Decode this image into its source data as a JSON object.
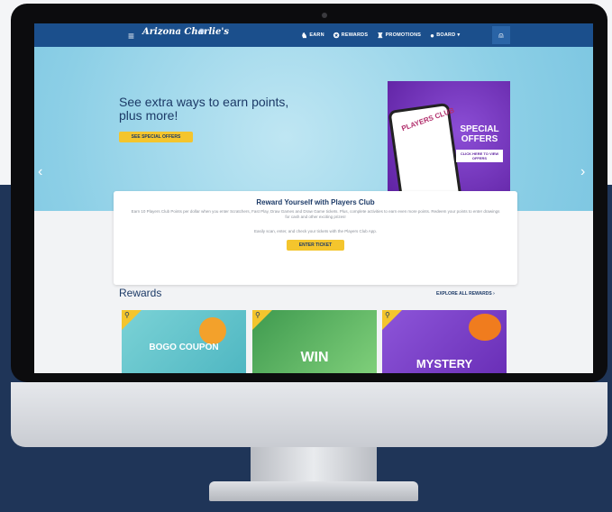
{
  "brand": {
    "logo_text": "Arizona Charlie's"
  },
  "nav": {
    "items": [
      {
        "label": "EARN",
        "icon": "earn-icon"
      },
      {
        "label": "REWARDS",
        "icon": "rewards-icon"
      },
      {
        "label": "PROMOTIONS",
        "icon": "promotions-icon"
      },
      {
        "label": "BOARD",
        "icon": "board-icon"
      }
    ]
  },
  "hero": {
    "title": "See extra ways to earn points, plus more!",
    "button": "SEE SPECIAL OFFERS",
    "promo": {
      "title": "SPECIAL OFFERS",
      "tag": "CLICK HERE TO VIEW OFFERS",
      "phone_text": "PLAYERS CLUB"
    },
    "slides": 3,
    "active_slide": 3
  },
  "players_club": {
    "title": "Reward Yourself with Players Club",
    "body": "Earn 10 Players Club Points per dollar when you enter Scratchers, Fast Play, Draw Games and Draw Game tickets. Plus, complete activities to earn even more points. Redeem your points to enter drawings for cash and other exciting prizes!",
    "sub": "Easily scan, enter, and check your tickets with the Players Club App.",
    "button": "ENTER TICKET"
  },
  "rewards": {
    "heading": "Rewards",
    "link": "EXPLORE ALL REWARDS",
    "tiles": [
      {
        "label": "BOGO COUPON"
      },
      {
        "label": "WIN"
      },
      {
        "label": "MYSTERY"
      }
    ]
  },
  "colors": {
    "nav_bg": "#1b4f8c",
    "accent_yellow": "#f4c52d",
    "navy_text": "#1c3a67",
    "page_bottom": "#1f3558"
  }
}
